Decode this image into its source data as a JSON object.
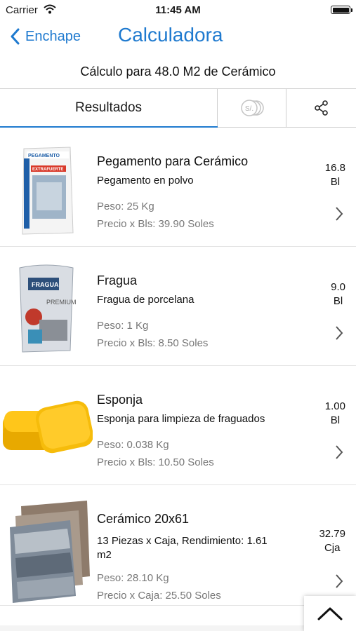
{
  "status_bar": {
    "carrier": "Carrier",
    "time": "11:45 AM"
  },
  "nav": {
    "back_label": "Enchape",
    "title": "Calculadora"
  },
  "subtitle": "Cálculo para 48.0 M2 de Cerámico",
  "tabs": {
    "results_label": "Resultados",
    "currency_icon_text": "S/."
  },
  "items": [
    {
      "name": "Pegamento para Cerámico",
      "desc": "Pegamento en polvo",
      "weight": "Peso: 25 Kg",
      "price": "Precio x Bls: 39.90 Soles",
      "qty": "16.8",
      "unit": "Bl"
    },
    {
      "name": "Fragua",
      "desc": "Fragua de porcelana",
      "weight": "Peso: 1 Kg",
      "price": "Precio x Bls: 8.50 Soles",
      "qty": "9.0",
      "unit": "Bl"
    },
    {
      "name": "Esponja",
      "desc": "Esponja para limpieza de fraguados",
      "weight": "Peso: 0.038 Kg",
      "price": "Precio x Bls: 10.50 Soles",
      "qty": "1.00",
      "unit": "Bl"
    },
    {
      "name": "Cerámico 20x61",
      "desc": "13 Piezas x Caja, Rendimiento: 1.61 m2",
      "weight": "Peso: 28.10 Kg",
      "price": "Precio x Caja: 25.50 Soles",
      "qty": "32.79",
      "unit": "Cja"
    }
  ],
  "product_art": {
    "bag1_brand": "PEGAMENTO",
    "bag1_badge": "EXTRAFUERTE",
    "bag2_brand": "FRAGUA",
    "bag2_badge": "PREMIUM"
  },
  "colors": {
    "accent": "#1f7acf",
    "muted_text": "#777777"
  }
}
